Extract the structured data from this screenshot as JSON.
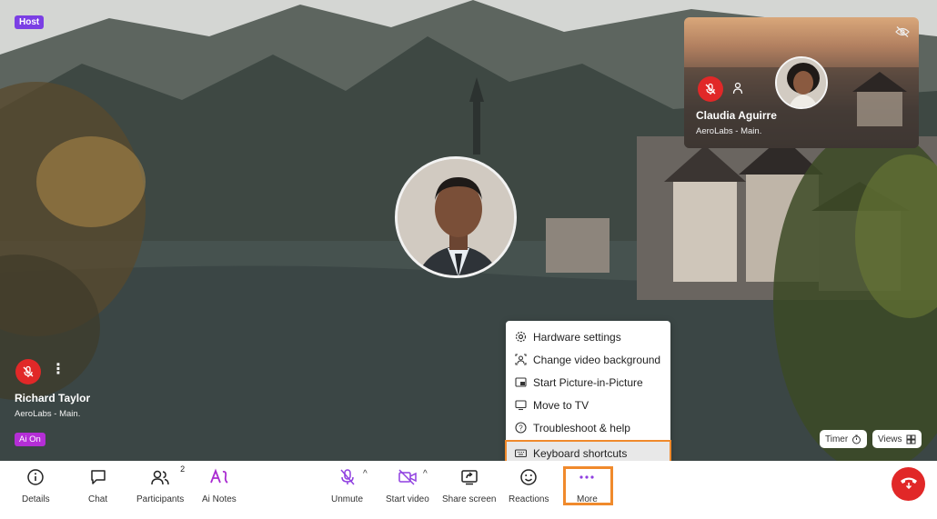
{
  "stage": {
    "host_badge": "Host",
    "left_participant": {
      "name": "Richard Taylor",
      "org": "AeroLabs - Main.",
      "ai_badge": "Ai On",
      "mic_icon": "mic-off-icon",
      "menu_icon": "kebab-icon"
    },
    "self_tile": {
      "name": "Claudia Aguirre",
      "org": "AeroLabs - Main.",
      "hide_icon": "eye-off-icon",
      "mic_icon": "mic-off-icon",
      "person_icon": "person-icon"
    },
    "timer_label": "Timer",
    "views_label": "Views"
  },
  "more_menu": {
    "items": [
      {
        "label": "Hardware settings",
        "icon": "gear-icon"
      },
      {
        "label": "Change video background",
        "icon": "background-icon"
      },
      {
        "label": "Start Picture-in-Picture",
        "icon": "pip-icon"
      },
      {
        "label": "Move to TV",
        "icon": "tv-icon"
      },
      {
        "label": "Troubleshoot & help",
        "icon": "help-icon"
      },
      {
        "label": "Keyboard shortcuts",
        "icon": "keyboard-icon",
        "highlighted": true
      }
    ]
  },
  "toolbar": {
    "details": "Details",
    "chat": "Chat",
    "participants": "Participants",
    "participants_count": "2",
    "ai_notes": "Ai Notes",
    "unmute": "Unmute",
    "start_video": "Start video",
    "share_screen": "Share screen",
    "reactions": "Reactions",
    "more": "More"
  },
  "colors": {
    "accent_purple": "#7b3fe4",
    "danger_red": "#e12828",
    "highlight_orange": "#f08a2c",
    "ai_magenta": "#b42ed6"
  }
}
